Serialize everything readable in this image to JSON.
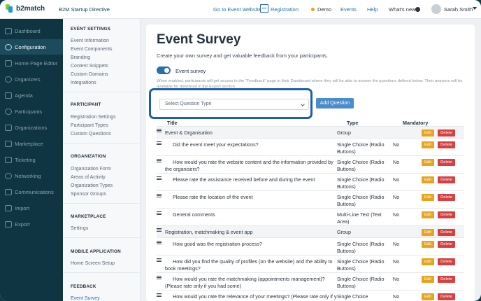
{
  "topbar": {
    "logo_text": "b2match",
    "event_name": "B2M Startup Directive",
    "go_to_event": "Go to Event Website",
    "registration": "Registration",
    "demo": "Demo",
    "events": "Events",
    "help": "Help",
    "whats_new": "What's new",
    "user_name": "Sarah Smith"
  },
  "sidebar": {
    "items": [
      {
        "label": "Dashboard",
        "icon": "dashboard-icon"
      },
      {
        "label": "Configuration",
        "icon": "gear-icon"
      },
      {
        "label": "Home Page Editor",
        "icon": "page-icon"
      },
      {
        "label": "Organizers",
        "icon": "organizers-icon"
      },
      {
        "label": "Agenda",
        "icon": "calendar-icon"
      },
      {
        "label": "Participants",
        "icon": "participants-icon"
      },
      {
        "label": "Organizations",
        "icon": "building-icon"
      },
      {
        "label": "Marketplace",
        "icon": "marketplace-icon"
      },
      {
        "label": "Ticketing",
        "icon": "ticket-icon"
      },
      {
        "label": "Networking",
        "icon": "networking-icon"
      },
      {
        "label": "Communications",
        "icon": "chat-icon"
      },
      {
        "label": "Import",
        "icon": "import-icon"
      },
      {
        "label": "Export",
        "icon": "export-icon"
      }
    ]
  },
  "subnav": {
    "event_settings": {
      "title": "EVENT SETTINGS",
      "items": [
        "Event Information",
        "Event Components",
        "Branding",
        "Content Snippets",
        "Custom Domains",
        "Integrations"
      ]
    },
    "participant": {
      "title": "PARTICIPANT",
      "items": [
        "Registration Settings",
        "Participant Types",
        "Custom Questions"
      ]
    },
    "organization": {
      "title": "ORGANIZATION",
      "items": [
        "Organization Form",
        "Areas of Activity",
        "Organization Types",
        "Sponsor Groups"
      ]
    },
    "marketplace": {
      "title": "MARKETPLACE",
      "items": [
        "Settings"
      ]
    },
    "mobile": {
      "title": "MOBILE APPLICATION",
      "items": [
        "Home Screen Setup"
      ]
    },
    "feedback": {
      "title": "FEEDBACK",
      "items": [
        "Event Survey"
      ]
    }
  },
  "main": {
    "title": "Event Survey",
    "subtitle": "Create your own survey and get valuable feedback from your participants.",
    "toggle_label": "Event survey",
    "toggle_on": true,
    "note": "When enabled, participants will get access to the \"Feedback\" page in their Dashboard where they will be able to answer the questions defined below. Their answers will be available for download in the Export section.",
    "select_placeholder": "Select Question Type",
    "add_button": "Add Question",
    "headers": {
      "title": "Title",
      "type": "Type",
      "mandatory": "Mandatory"
    },
    "edit_label": "Edit",
    "delete_label": "Delete",
    "rows": [
      {
        "title": "Event & Organisation",
        "type": "Group",
        "mandatory": "",
        "group": true
      },
      {
        "title": "Did the event meet your expectations?",
        "type": "Single Choice (Radio Buttons)",
        "mandatory": "No"
      },
      {
        "title": "How would you rate the website content and the information provided by the organisers?",
        "type": "Single Choice (Radio Buttons)",
        "mandatory": "No"
      },
      {
        "title": "Please rate the assistance received before and during the event",
        "type": "Single Choice (Radio Buttons)",
        "mandatory": "No"
      },
      {
        "title": "Please rate the location of the event",
        "type": "Single Choice (Radio Buttons)",
        "mandatory": "No"
      },
      {
        "title": "General comments",
        "type": "Multi-Line Text (Text Area)",
        "mandatory": "No"
      },
      {
        "title": "Registration, matchmaking & event app",
        "type": "Group",
        "mandatory": "",
        "group": true
      },
      {
        "title": "How good was the registration process?",
        "type": "Single Choice (Radio Buttons)",
        "mandatory": "No"
      },
      {
        "title": "How did you find the quality of profiles (on the website) and the ability to book meetings?",
        "type": "Single Choice (Radio Buttons)",
        "mandatory": "No"
      },
      {
        "title": "How would you rate the matchmaking (appointments management)? (Please rate only if you had some)",
        "type": "Single Choice (Radio Buttons)",
        "mandatory": "No"
      },
      {
        "title": "How would you rate the relevance of your meetings? (Please rate only if you",
        "type": "Single Choice",
        "mandatory": "No"
      }
    ]
  }
}
